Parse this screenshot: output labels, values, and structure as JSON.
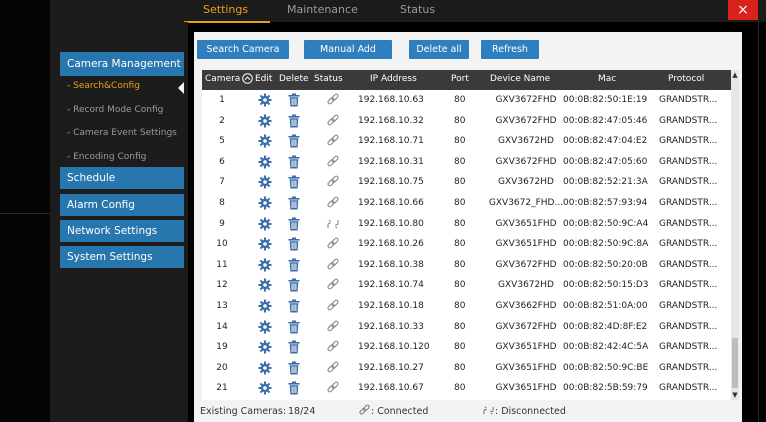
{
  "top_tabs": [
    {
      "label": "Settings",
      "active": true
    },
    {
      "label": "Maintenance",
      "active": false
    },
    {
      "label": "Status",
      "active": false
    }
  ],
  "close_label": "×",
  "sidebar": {
    "camera_management": "Camera Management",
    "sub_items": [
      {
        "label": "- Search&Config",
        "active": true
      },
      {
        "label": "- Record Mode Config",
        "active": false
      },
      {
        "label": "- Camera Event Settings",
        "active": false
      },
      {
        "label": "- Encoding Config",
        "active": false
      }
    ],
    "schedule": "Schedule",
    "alarm_config": "Alarm Config",
    "network_settings": "Network Settings",
    "system_settings": "System Settings"
  },
  "toolbar": {
    "search_camera": "Search Camera",
    "manual_add": "Manual Add",
    "delete_all": "Delete all",
    "refresh": "Refresh"
  },
  "table": {
    "headers": {
      "camera": "Camera",
      "edit": "Edit",
      "delete": "Delete",
      "status": "Status",
      "ip": "IP Address",
      "port": "Port",
      "device": "Device Name",
      "mac": "Mac",
      "protocol": "Protocol"
    },
    "rows": [
      {
        "camera": "1",
        "status": "connected",
        "ip": "192.168.10.63",
        "port": "80",
        "device": "GXV3672FHD",
        "mac": "00:0B:82:50:1E:19",
        "protocol": "GRANDSTR..."
      },
      {
        "camera": "2",
        "status": "connected",
        "ip": "192.168.10.32",
        "port": "80",
        "device": "GXV3672FHD",
        "mac": "00:0B:82:47:05:46",
        "protocol": "GRANDSTR..."
      },
      {
        "camera": "5",
        "status": "connected",
        "ip": "192.168.10.71",
        "port": "80",
        "device": "GXV3672HD",
        "mac": "00:0B:82:47:04:E2",
        "protocol": "GRANDSTR..."
      },
      {
        "camera": "6",
        "status": "connected",
        "ip": "192.168.10.31",
        "port": "80",
        "device": "GXV3672FHD",
        "mac": "00:0B:82:47:05:60",
        "protocol": "GRANDSTR..."
      },
      {
        "camera": "7",
        "status": "connected",
        "ip": "192.168.10.75",
        "port": "80",
        "device": "GXV3672HD",
        "mac": "00:0B:82:52:21:3A",
        "protocol": "GRANDSTR..."
      },
      {
        "camera": "8",
        "status": "connected",
        "ip": "192.168.10.66",
        "port": "80",
        "device": "GXV3672_FHD...",
        "mac": "00:0B:82:57:93:94",
        "protocol": "GRANDSTR..."
      },
      {
        "camera": "9",
        "status": "disconnected",
        "ip": "192.168.10.80",
        "port": "80",
        "device": "GXV3651FHD",
        "mac": "00:0B:82:50:9C:A4",
        "protocol": "GRANDSTR..."
      },
      {
        "camera": "10",
        "status": "connected",
        "ip": "192.168.10.26",
        "port": "80",
        "device": "GXV3651FHD",
        "mac": "00:0B:82:50:9C:8A",
        "protocol": "GRANDSTR..."
      },
      {
        "camera": "11",
        "status": "connected",
        "ip": "192.168.10.38",
        "port": "80",
        "device": "GXV3672FHD",
        "mac": "00:0B:82:50:20:0B",
        "protocol": "GRANDSTR..."
      },
      {
        "camera": "12",
        "status": "connected",
        "ip": "192.168.10.74",
        "port": "80",
        "device": "GXV3672HD",
        "mac": "00:0B:82:50:15:D3",
        "protocol": "GRANDSTR..."
      },
      {
        "camera": "13",
        "status": "connected",
        "ip": "192.168.10.18",
        "port": "80",
        "device": "GXV3662FHD",
        "mac": "00:0B:82:51:0A:00",
        "protocol": "GRANDSTR..."
      },
      {
        "camera": "14",
        "status": "connected",
        "ip": "192.168.10.33",
        "port": "80",
        "device": "GXV3672FHD",
        "mac": "00:0B:82:4D:8F:E2",
        "protocol": "GRANDSTR..."
      },
      {
        "camera": "19",
        "status": "connected",
        "ip": "192.168.10.120",
        "port": "80",
        "device": "GXV3651FHD",
        "mac": "00:0B:82:42:4C:5A",
        "protocol": "GRANDSTR..."
      },
      {
        "camera": "20",
        "status": "connected",
        "ip": "192.168.10.27",
        "port": "80",
        "device": "GXV3651FHD",
        "mac": "00:0B:82:50:9C:BE",
        "protocol": "GRANDSTR..."
      },
      {
        "camera": "21",
        "status": "connected",
        "ip": "192.168.10.67",
        "port": "80",
        "device": "GXV3651FHD",
        "mac": "00:0B:82:5B:59:79",
        "protocol": "GRANDSTR..."
      }
    ]
  },
  "footer": {
    "existing_label": "Existing Cameras:",
    "existing_value": "18/24",
    "connected_label": ": Connected",
    "disconnected_label": ": Disconnected"
  },
  "colors": {
    "accent": "#e8a017",
    "button_blue": "#2f7fbf",
    "close_red": "#d9221c",
    "table_header": "#3a3a3a"
  },
  "icons": {
    "edit": "gear-icon",
    "delete": "trash-icon",
    "connected": "link-icon",
    "disconnected": "broken-link-icon",
    "sort": "sort-up-icon"
  }
}
